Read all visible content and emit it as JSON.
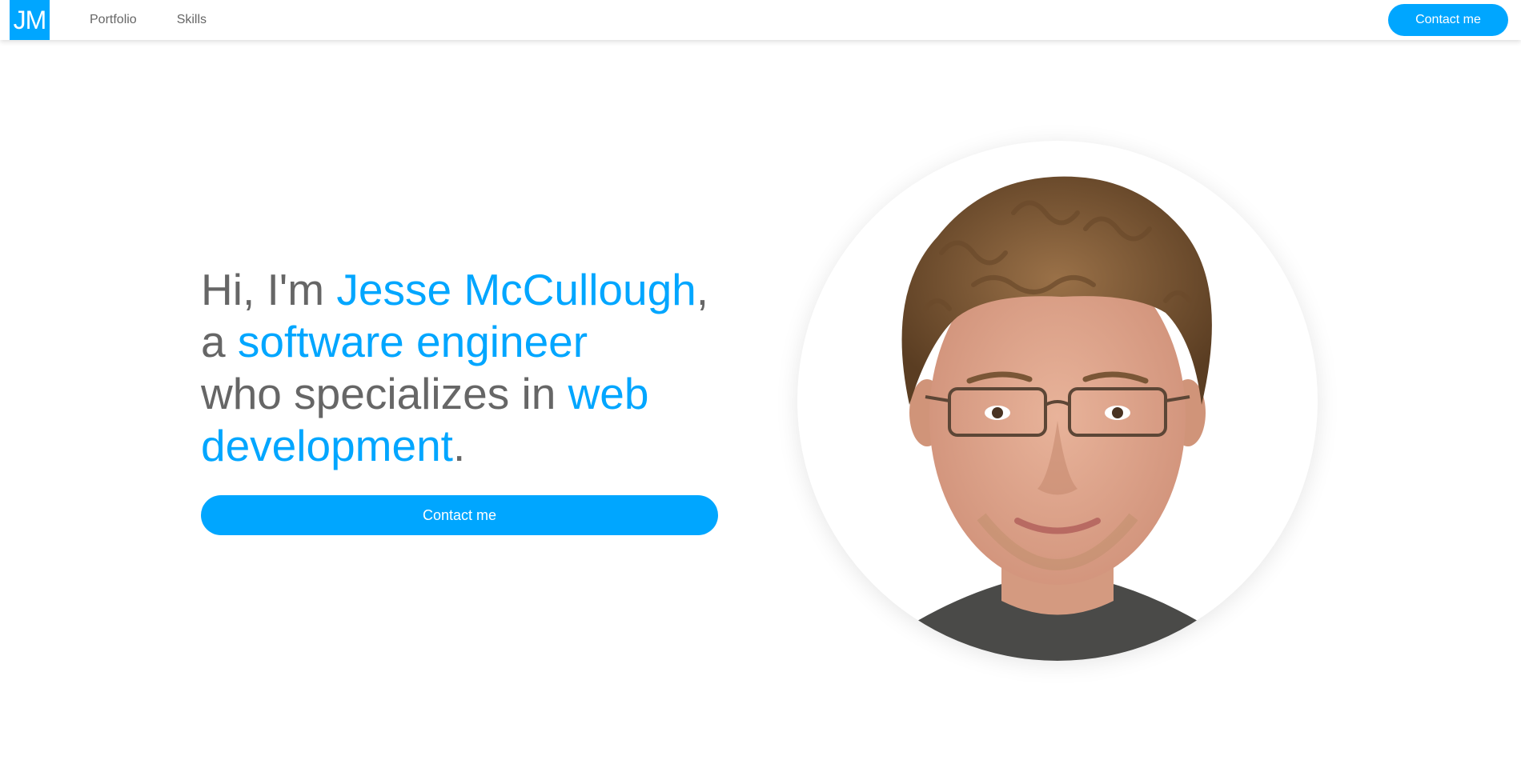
{
  "brand": {
    "logo_text": "JM",
    "accent_color": "#00a6ff",
    "text_color": "#666666"
  },
  "nav": {
    "links": [
      {
        "label": "Portfolio"
      },
      {
        "label": "Skills"
      }
    ],
    "contact_label": "Contact me"
  },
  "hero": {
    "line1_prefix": "Hi, I'm ",
    "name": "Jesse McCullough",
    "line1_suffix": ",",
    "line2_prefix": "a ",
    "role": "software engineer",
    "line3_prefix": "who specializes in ",
    "specialty": "web development",
    "specialty_suffix": ".",
    "contact_label": "Contact me"
  },
  "portrait": {
    "icon": "profile-photo"
  }
}
